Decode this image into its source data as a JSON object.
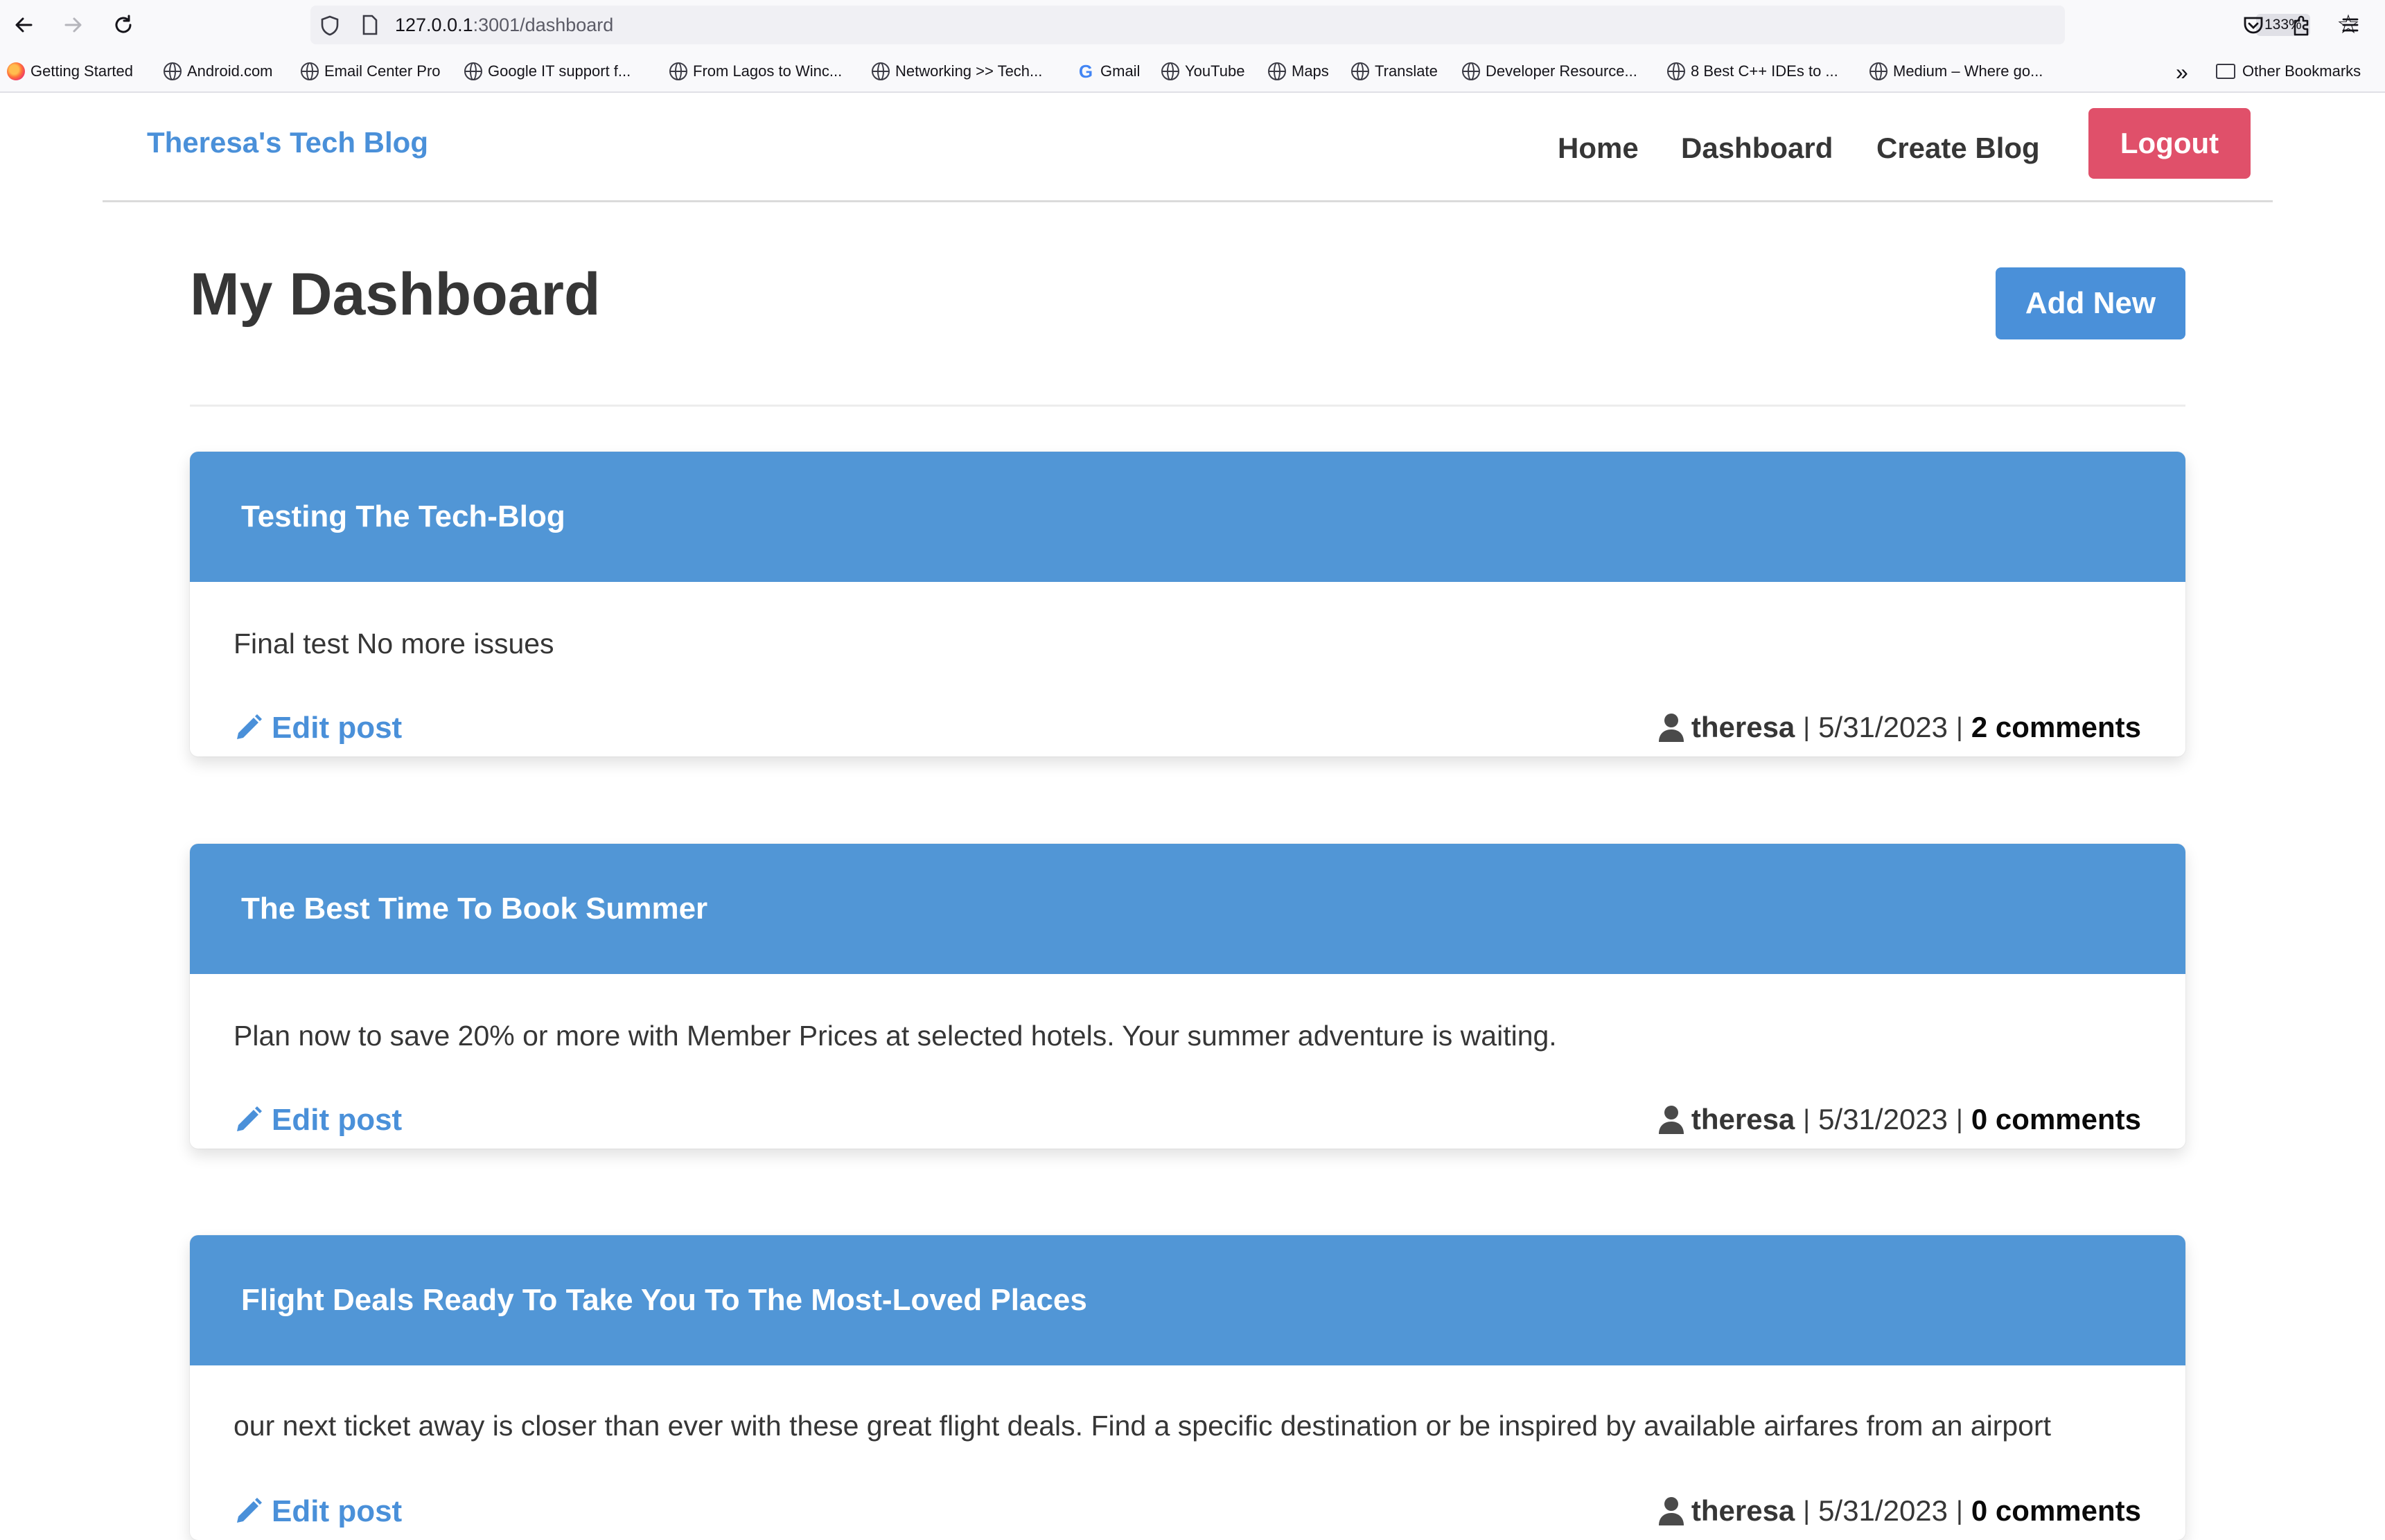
{
  "browser": {
    "url_host": "127.0.0.1",
    "url_path": ":3001/dashboard",
    "zoom": "133%",
    "bookmarks": [
      "Getting Started",
      "Android.com",
      "Email Center Pro",
      "Google IT support f...",
      "From Lagos to Winc...",
      "Networking >> Tech...",
      "Gmail",
      "YouTube",
      "Maps",
      "Translate",
      "Developer Resource...",
      "8 Best C++ IDEs to ...",
      "Medium – Where go...",
      "Other Bookmarks"
    ]
  },
  "site": {
    "brand": "Theresa's Tech Blog",
    "nav": [
      "Home",
      "Dashboard",
      "Create Blog"
    ],
    "logout_label": "Logout"
  },
  "dashboard": {
    "title": "My Dashboard",
    "add_new_label": "Add New",
    "posts": [
      {
        "title": "Testing The Tech-Blog",
        "body": "Final test No more issues",
        "edit_label": "Edit post",
        "author": "theresa",
        "date": "5/31/2023",
        "comments": "2 comments"
      },
      {
        "title": "The Best Time To Book Summer",
        "body": "Plan now to save 20% or more with Member Prices at selected hotels. Your summer adventure is waiting.",
        "edit_label": "Edit post",
        "author": "theresa",
        "date": "5/31/2023",
        "comments": "0 comments"
      },
      {
        "title": "Flight Deals Ready To Take You To The Most-Loved Places",
        "body": "our next ticket away is closer than ever with these great flight deals. Find a specific destination or be inspired by available airfares from an airport",
        "edit_label": "Edit post",
        "author": "theresa",
        "date": "5/31/2023",
        "comments": "0 comments"
      }
    ]
  },
  "colors": {
    "primary": "#4a90d9",
    "card_header": "#5196d6",
    "danger": "#e0506a",
    "text": "#363636"
  }
}
